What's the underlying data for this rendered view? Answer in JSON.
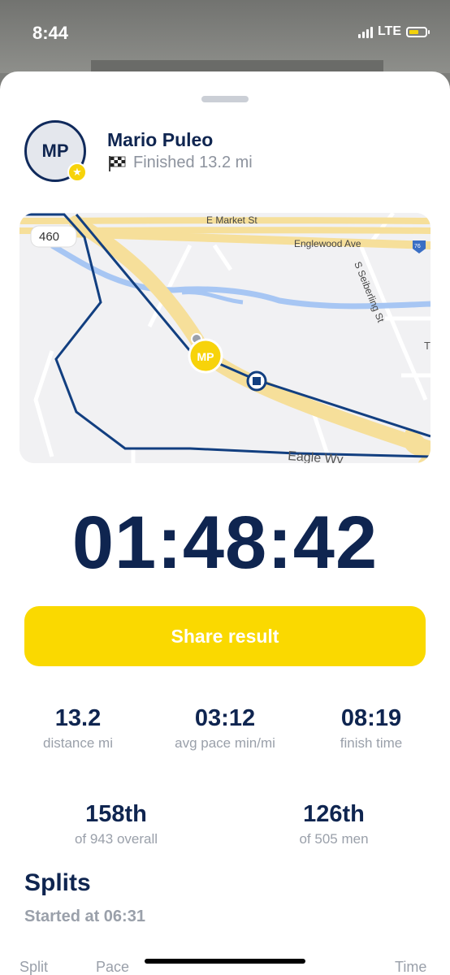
{
  "status": {
    "time": "8:44",
    "network": "LTE"
  },
  "runner": {
    "initials": "MP",
    "name": "Mario Puleo",
    "finished": "Finished 13.2 mi"
  },
  "map": {
    "route_marker": "460",
    "streets": [
      "E Market St",
      "Englewood Ave",
      "S Seiberling St",
      "Eagle Wy",
      "76",
      "T"
    ],
    "runner_marker": "MP"
  },
  "timer": "01:48:42",
  "share_label": "Share result",
  "stats": {
    "distance": {
      "value": "13.2",
      "label": "distance mi"
    },
    "pace": {
      "value": "03:12",
      "label": "avg pace min/mi"
    },
    "finish": {
      "value": "08:19",
      "label": "finish time"
    },
    "overall": {
      "value": "158th",
      "label": "of 943 overall"
    },
    "gender": {
      "value": "126th",
      "label": "of 505 men"
    }
  },
  "splits": {
    "title": "Splits",
    "started": "Started at 06:31",
    "columns": [
      "Split",
      "Pace",
      "Time"
    ]
  },
  "colors": {
    "navy": "#0f2550",
    "accent_yellow": "#fad900",
    "muted": "#9aa0aa"
  }
}
